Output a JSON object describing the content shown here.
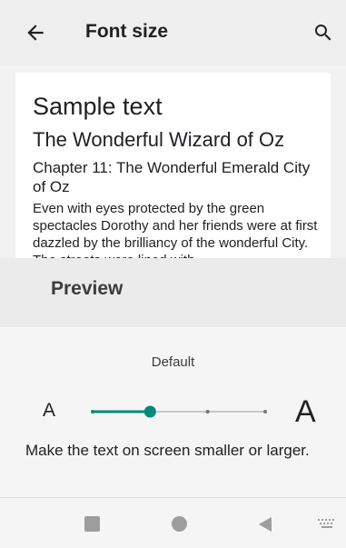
{
  "appbar": {
    "title": "Font size",
    "back_icon": "arrow-back-icon",
    "search_icon": "search-icon"
  },
  "sample": {
    "title": "Sample text",
    "book": "The Wonderful Wizard of Oz",
    "chapter": "Chapter 11: The Wonderful Emerald City of Oz",
    "body": "Even with eyes protected by the green spectacles Dorothy and her friends were at first dazzled by the brilliancy of the wonderful City. The streets were lined with"
  },
  "preview": {
    "label": "Preview"
  },
  "font_size": {
    "current_label": "Default",
    "small_label": "A",
    "large_label": "A",
    "steps": 4,
    "current_step": 2,
    "accent_color": "#00897b",
    "helper_text": "Make the text on screen smaller or larger."
  },
  "navbar": {
    "recents_icon": "square-recents-icon",
    "home_icon": "circle-home-icon",
    "back_icon": "triangle-back-icon",
    "keyboard_icon": "keyboard-icon"
  }
}
